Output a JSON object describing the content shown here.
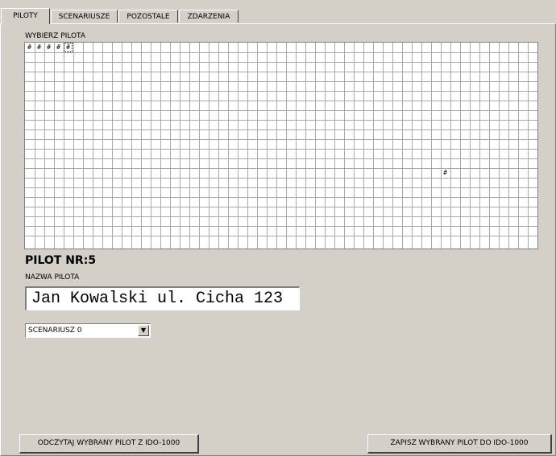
{
  "tabs": [
    {
      "label": "PILOTY",
      "active": true
    },
    {
      "label": "SCENARIUSZE",
      "active": false
    },
    {
      "label": "POZOSTALE",
      "active": false
    },
    {
      "label": "ZDARZENIA",
      "active": false
    }
  ],
  "grid": {
    "label": "WYBIERZ PILOTA",
    "columns": 53,
    "rows": 21,
    "mark_symbol": "#",
    "marked_cells": [
      {
        "row": 0,
        "col": 0
      },
      {
        "row": 0,
        "col": 1
      },
      {
        "row": 0,
        "col": 2
      },
      {
        "row": 0,
        "col": 3
      },
      {
        "row": 0,
        "col": 4,
        "selected": true
      },
      {
        "row": 13,
        "col": 43
      }
    ]
  },
  "pilot": {
    "number_label": "PILOT NR:5",
    "name_label": "NAZWA PILOTA",
    "name_value": "Jan Kowalski ul. Cicha 123"
  },
  "scenario_select": {
    "selected": "SCENARIUSZ 0",
    "arrow_icon": "▼"
  },
  "buttons": {
    "read": "ODCZYTAJ WYBRANY PILOT  Z IDO-1000",
    "save": "ZAPISZ WYBRANY PILOT DO IDO-1000"
  },
  "colors": {
    "background": "#d4d0c8",
    "grid_background": "#ffffff",
    "grid_line": "#aaaaaa"
  }
}
